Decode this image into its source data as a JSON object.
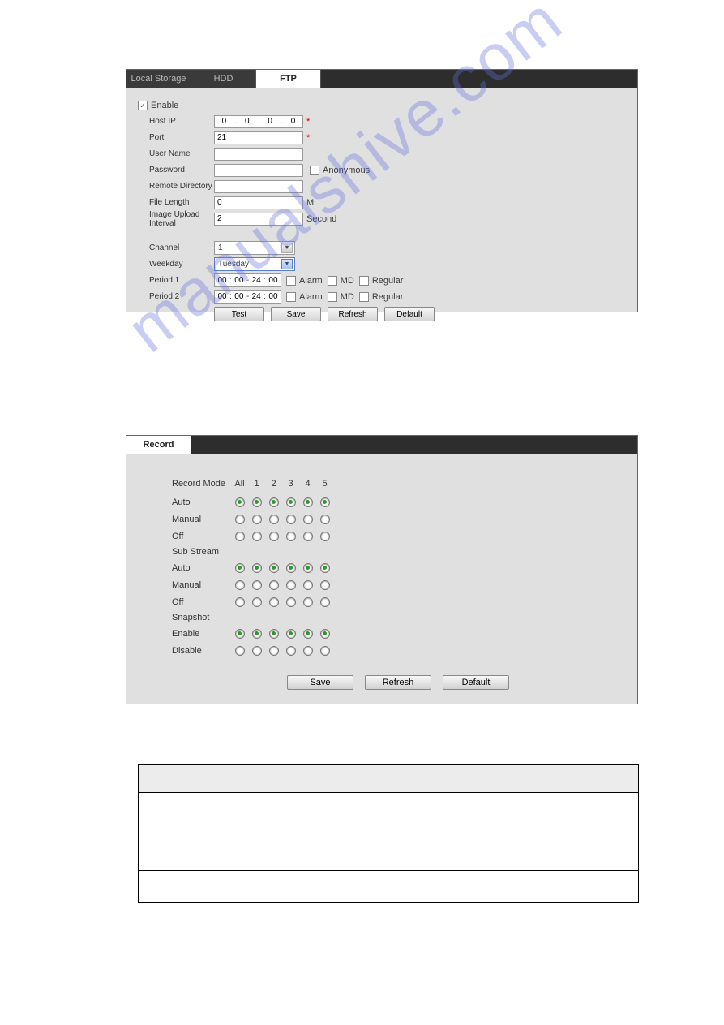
{
  "ftp": {
    "tabs": {
      "local": "Local Storage",
      "hdd": "HDD",
      "ftp": "FTP"
    },
    "enable_label": "Enable",
    "enable_checked": true,
    "host_ip_label": "Host IP",
    "host_ip": [
      "0",
      "0",
      "0",
      "0"
    ],
    "port_label": "Port",
    "port_value": "21",
    "username_label": "User Name",
    "username_value": "",
    "password_label": "Password",
    "password_value": "",
    "anonymous_label": "Anonymous",
    "remote_dir_label": "Remote Directory",
    "remote_dir_value": "",
    "file_length_label": "File Length",
    "file_length_value": "0",
    "file_length_unit": "M",
    "upload_interval_label": "Image Upload Interval",
    "upload_interval_value": "2",
    "upload_interval_unit": "Second",
    "channel_label": "Channel",
    "channel_value": "1",
    "weekday_label": "Weekday",
    "weekday_value": "Tuesday",
    "period1_label": "Period 1",
    "period1": [
      "00",
      "00",
      "24",
      "00"
    ],
    "period2_label": "Period 2",
    "period2": [
      "00",
      "00",
      "24",
      "00"
    ],
    "alarm_label": "Alarm",
    "md_label": "MD",
    "regular_label": "Regular",
    "btn_test": "Test",
    "btn_save": "Save",
    "btn_refresh": "Refresh",
    "btn_default": "Default"
  },
  "record": {
    "tab": "Record",
    "mode_label": "Record Mode",
    "columns": [
      "All",
      "1",
      "2",
      "3",
      "4",
      "5"
    ],
    "main_rows": [
      {
        "label": "Auto",
        "selected": [
          true,
          true,
          true,
          true,
          true,
          true
        ]
      },
      {
        "label": "Manual",
        "selected": [
          false,
          false,
          false,
          false,
          false,
          false
        ]
      },
      {
        "label": "Off",
        "selected": [
          false,
          false,
          false,
          false,
          false,
          false
        ]
      }
    ],
    "sub_header": "Sub Stream",
    "sub_rows": [
      {
        "label": "Auto",
        "selected": [
          true,
          true,
          true,
          true,
          true,
          true
        ]
      },
      {
        "label": "Manual",
        "selected": [
          false,
          false,
          false,
          false,
          false,
          false
        ]
      },
      {
        "label": "Off",
        "selected": [
          false,
          false,
          false,
          false,
          false,
          false
        ]
      }
    ],
    "snap_header": "Snapshot",
    "snap_rows": [
      {
        "label": "Enable",
        "selected": [
          true,
          true,
          true,
          true,
          true,
          true
        ]
      },
      {
        "label": "Disable",
        "selected": [
          false,
          false,
          false,
          false,
          false,
          false
        ]
      }
    ],
    "btn_save": "Save",
    "btn_refresh": "Refresh",
    "btn_default": "Default"
  },
  "watermark": "manualshive.com"
}
